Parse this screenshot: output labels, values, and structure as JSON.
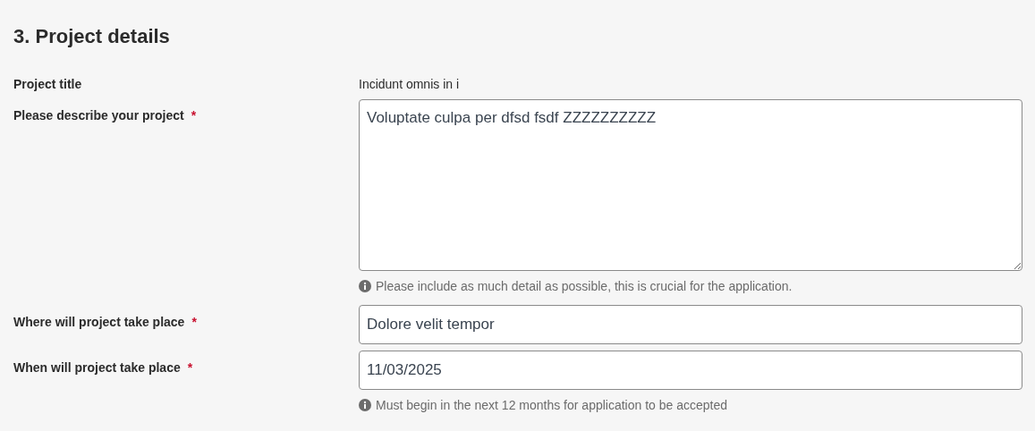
{
  "heading": "3. Project details",
  "fields": [
    {
      "kind": "static",
      "label": "Project title",
      "value": "Incidunt omnis in i"
    },
    {
      "kind": "textarea",
      "label": "Please describe your project",
      "required_mark": "*",
      "value": "Voluptate culpa per dfsd fsdf ZZZZZZZZZZ",
      "hint": "Please include as much detail as possible, this is crucial for the application."
    },
    {
      "kind": "text",
      "label": "Where will project take place",
      "required_mark": "*",
      "value": "Dolore velit tempor"
    },
    {
      "kind": "date",
      "label": "When will project take place",
      "required_mark": "*",
      "value": "11/03/2025",
      "hint": "Must begin in the next 12 months for application to be accepted"
    }
  ]
}
